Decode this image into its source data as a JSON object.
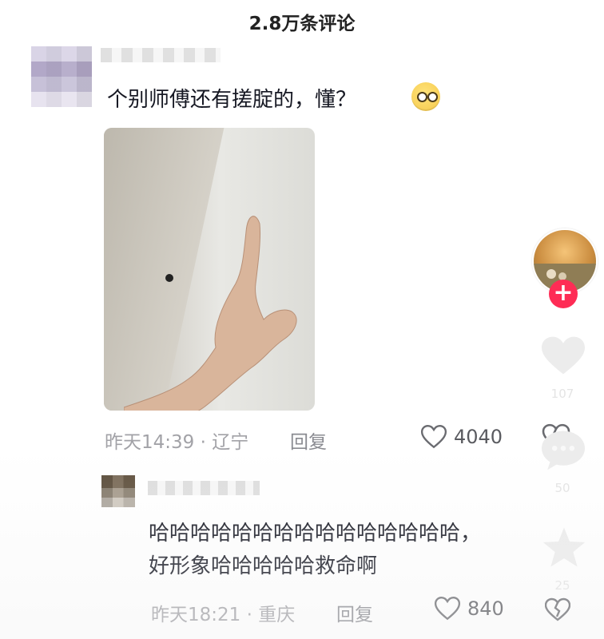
{
  "header": {
    "title": "2.8万条评论"
  },
  "comment": {
    "text": "个别师傅还有搓腚的，懂？",
    "emoji_icon": "smirk-face-emoji",
    "timestamp": "昨天14:39",
    "location": "辽宁",
    "meta_separator": "·",
    "reply_label": "回复",
    "likes": "4040"
  },
  "sub_comment": {
    "line1": "哈哈哈哈哈哈哈哈哈哈哈哈哈哈哈，",
    "line2": "好形象哈哈哈哈哈救命啊",
    "timestamp": "昨天18:21",
    "location": "重庆",
    "meta_separator": "·",
    "reply_label": "回复",
    "likes": "840"
  },
  "sidebar": {
    "follow_label": "+",
    "like_count": "107",
    "comment_count": "50",
    "favorite_count": "25"
  },
  "colors": {
    "accent": "#fe2c55",
    "text": "#161823",
    "meta": "#a2a2a7"
  }
}
